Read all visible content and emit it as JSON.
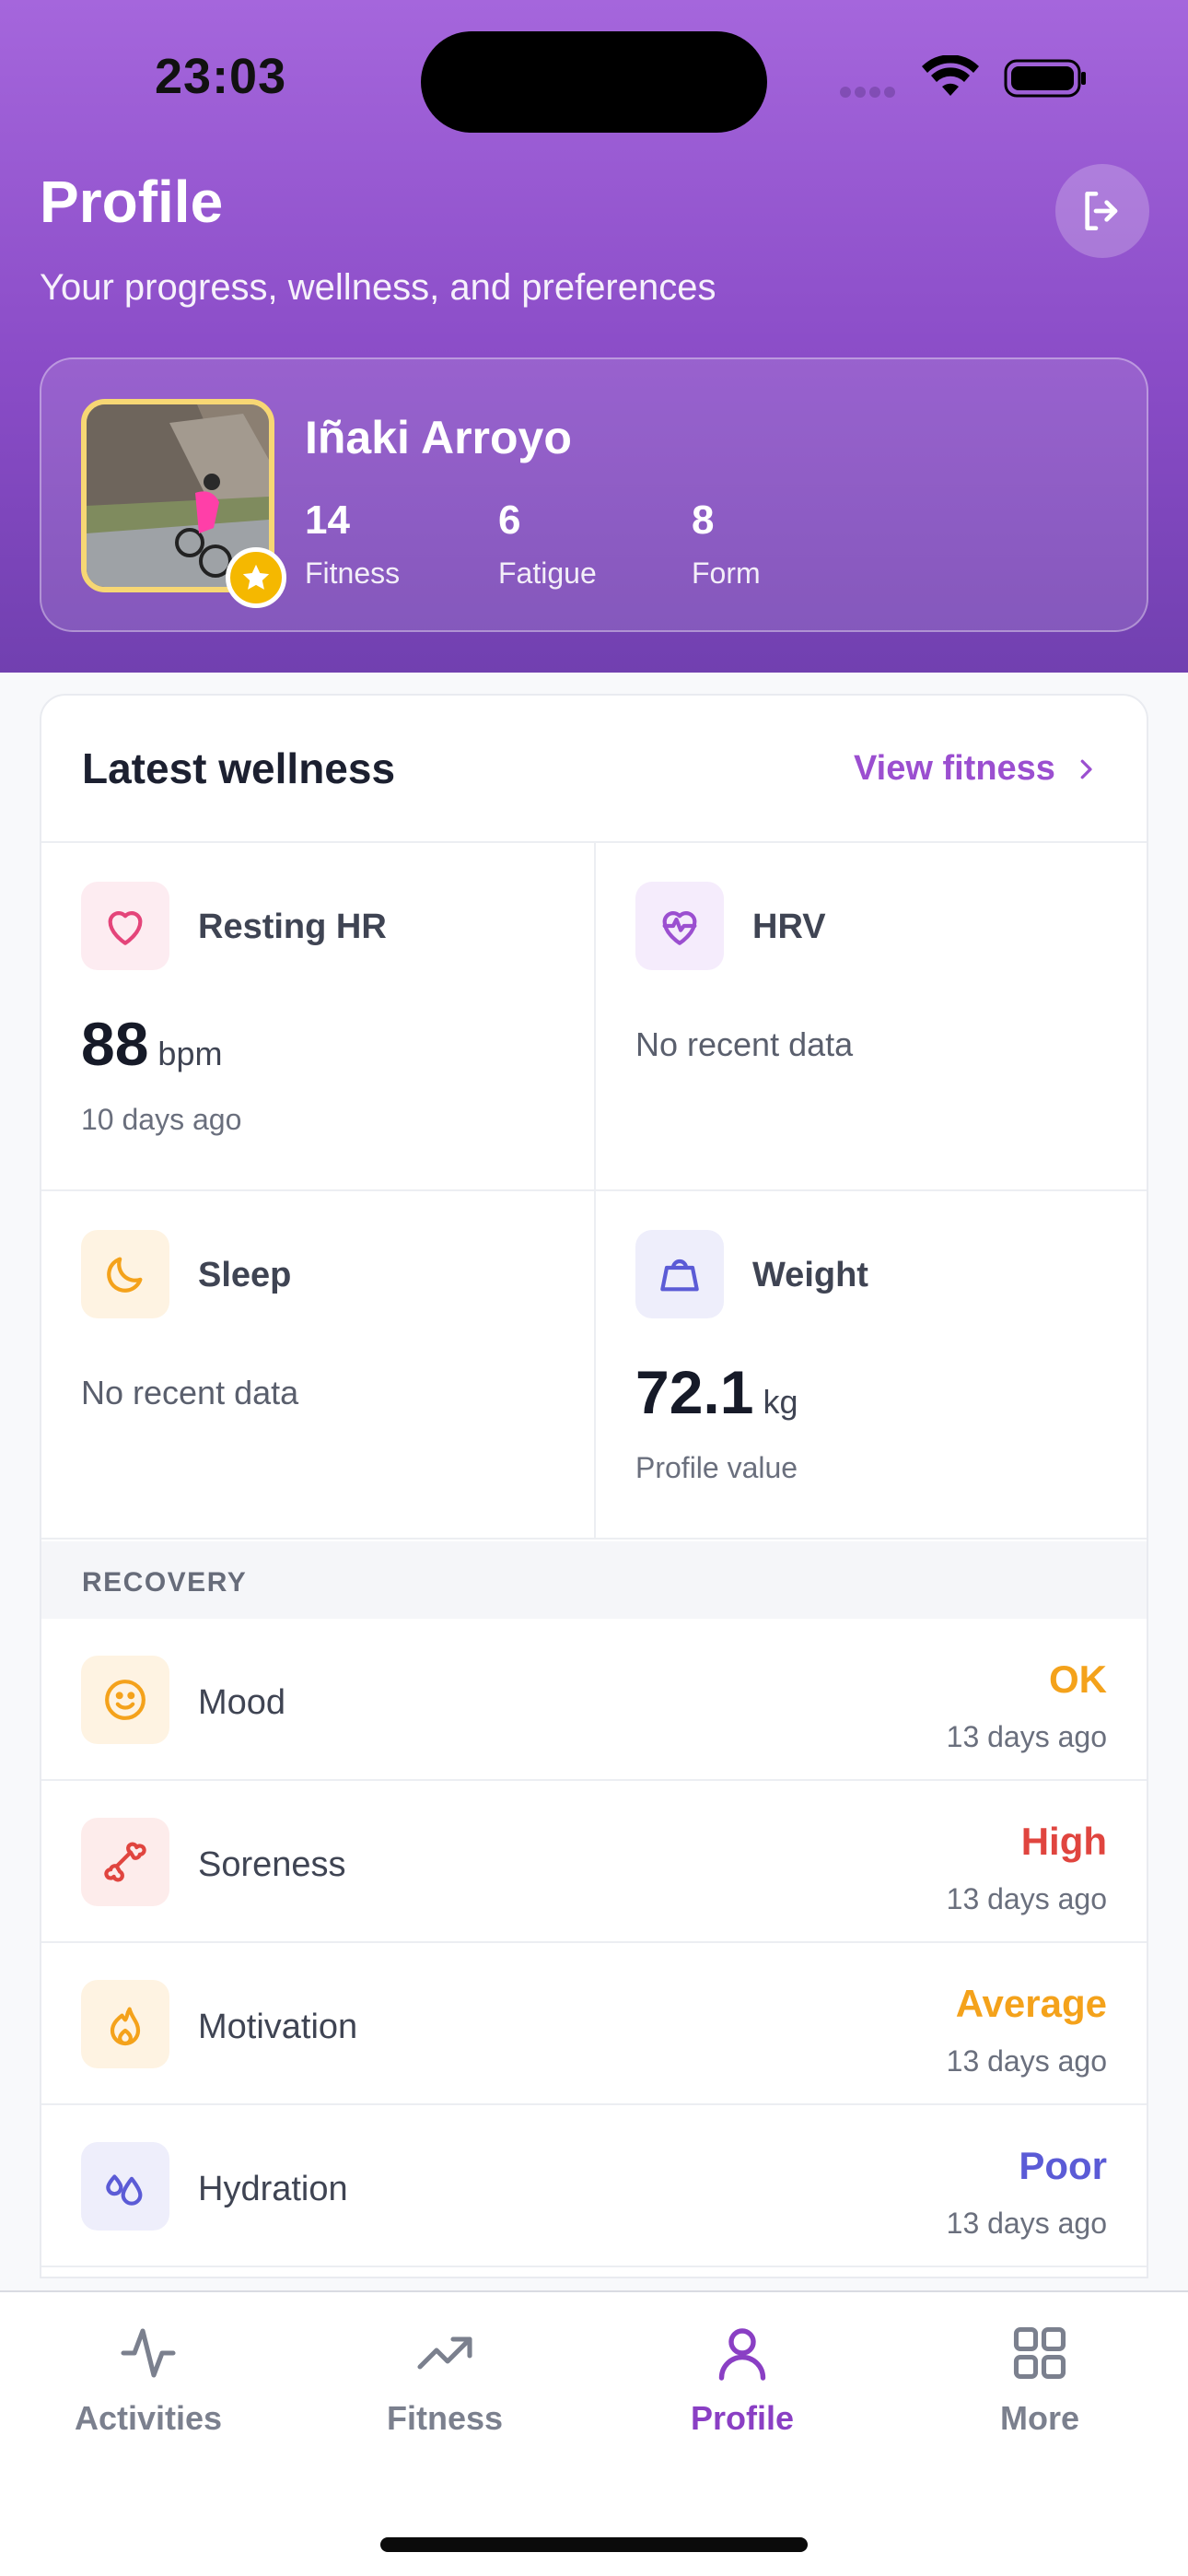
{
  "status_bar": {
    "time": "23:03"
  },
  "header": {
    "title": "Profile",
    "subtitle": "Your progress, wellness, and preferences"
  },
  "profile": {
    "name": "Iñaki Arroyo",
    "stats": [
      {
        "value": "14",
        "label": "Fitness"
      },
      {
        "value": "6",
        "label": "Fatigue"
      },
      {
        "value": "8",
        "label": "Form"
      }
    ]
  },
  "wellness": {
    "title": "Latest wellness",
    "view_link": "View fitness",
    "resting_hr": {
      "label": "Resting HR",
      "value": "88",
      "unit": "bpm",
      "sub": "10 days ago"
    },
    "hrv": {
      "label": "HRV",
      "empty": "No recent data"
    },
    "sleep": {
      "label": "Sleep",
      "empty": "No recent data"
    },
    "weight": {
      "label": "Weight",
      "value": "72.1",
      "unit": "kg",
      "sub": "Profile value"
    }
  },
  "recovery": {
    "heading": "RECOVERY",
    "items": [
      {
        "label": "Mood",
        "value": "OK",
        "time": "13 days ago",
        "color": "#f4a21b"
      },
      {
        "label": "Soreness",
        "value": "High",
        "time": "13 days ago",
        "color": "#e0453f"
      },
      {
        "label": "Motivation",
        "value": "Average",
        "time": "13 days ago",
        "color": "#f4a21b"
      },
      {
        "label": "Hydration",
        "value": "Poor",
        "time": "13 days ago",
        "color": "#5b5bd6"
      }
    ]
  },
  "tabs": [
    {
      "label": "Activities",
      "icon": "activity-icon"
    },
    {
      "label": "Fitness",
      "icon": "trending-up-icon"
    },
    {
      "label": "Profile",
      "icon": "user-icon",
      "active": true
    },
    {
      "label": "More",
      "icon": "grid-icon"
    }
  ],
  "colors": {
    "brand_purple": "#8a3fc4",
    "header_gradient_top": "#a566dc",
    "header_gradient_bottom": "#7140b0"
  }
}
